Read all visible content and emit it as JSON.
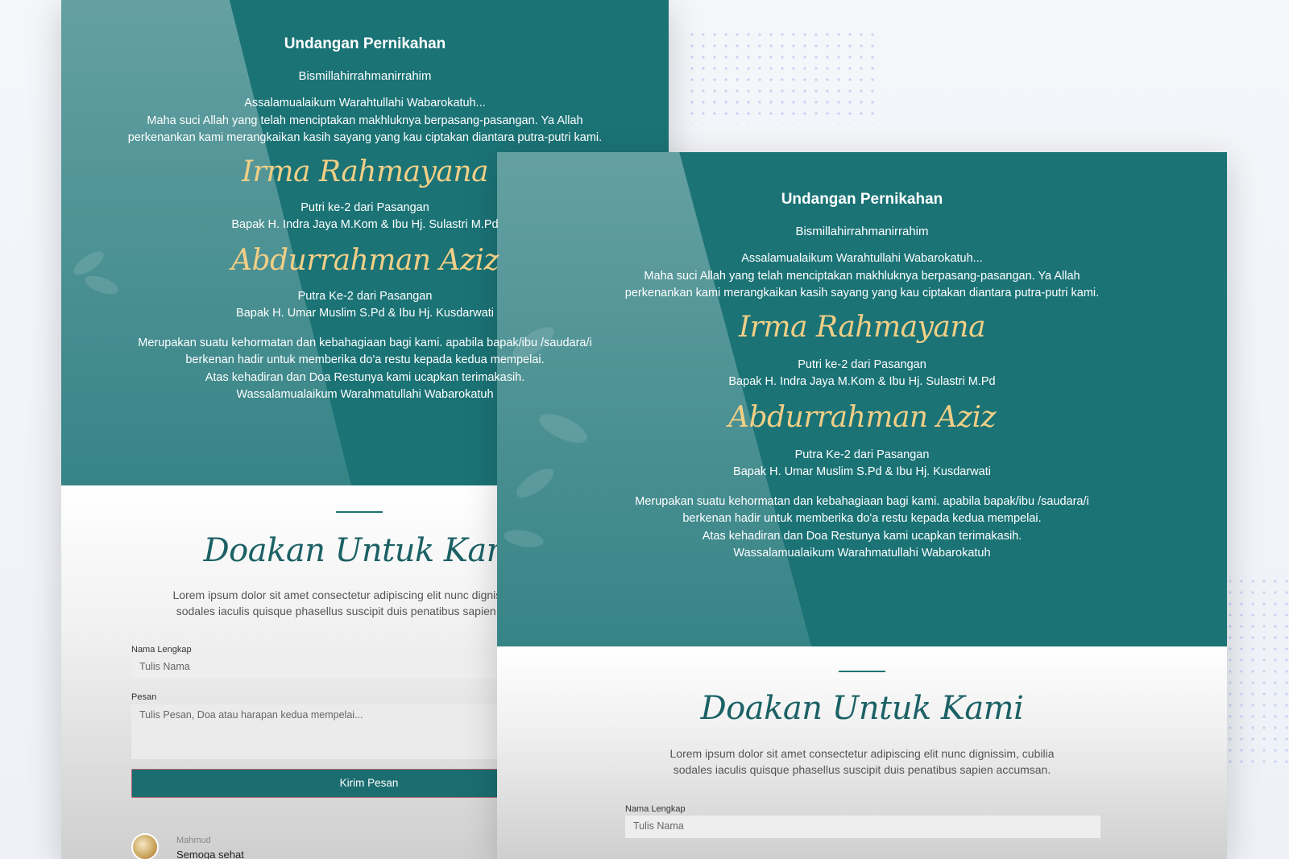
{
  "invitation": {
    "title": "Undangan Pernikahan",
    "bismillah": "Bismillahirrahmanirrahim",
    "greeting": "Assalamualaikum Warahtullahi Wabarokatuh...",
    "intro_line1": "Maha suci Allah yang telah menciptakan makhluknya berpasang-pasangan. Ya Allah",
    "intro_line2": "perkenankan kami merangkaikan kasih sayang yang kau ciptakan diantara putra-putri kami.",
    "bride_name": "Irma Rahmayana",
    "bride_child_of": "Putri ke-2 dari Pasangan",
    "bride_parents": "Bapak H. Indra Jaya M.Kom & Ibu Hj. Sulastri M.Pd",
    "groom_name": "Abdurrahman Aziz",
    "groom_child_of": "Putra Ke-2 dari Pasangan",
    "groom_parents": "Bapak H. Umar Muslim S.Pd & Ibu Hj. Kusdarwati",
    "closing_line1": "Merupakan suatu kehormatan dan kebahagiaan bagi kami. apabila bapak/ibu /saudara/i",
    "closing_line2": "berkenan hadir untuk memberika do'a restu kepada kedua mempelai.",
    "closing_line3": "Atas kehadiran dan Doa Restunya kami ucapkan terimakasih.",
    "closing_line4": "Wassalamualaikum Warahmatullahi Wabarokatuh"
  },
  "wishes": {
    "title": "Doakan Untuk Kami",
    "desc_line1": "Lorem ipsum dolor sit amet consectetur adipiscing elit nunc dignissim, cubilia",
    "desc_line2": "sodales iaculis quisque phasellus suscipit duis penatibus sapien accumsan.",
    "name_label": "Nama Lengkap",
    "name_placeholder": "Tulis Nama",
    "message_label": "Pesan",
    "message_placeholder": "Tulis Pesan, Doa atau harapan kedua mempelai...",
    "submit_label": "Kirim Pesan",
    "comments": [
      {
        "name": "Mahmud",
        "message": "Semoga sehat"
      }
    ]
  },
  "colors": {
    "teal": "#1b7376",
    "gold": "#f1cf86",
    "button": "#1b6d70"
  }
}
